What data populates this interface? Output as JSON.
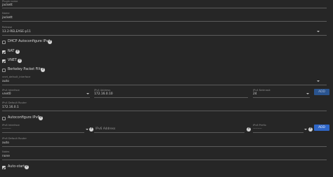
{
  "top_field": {
    "label": "Plugin name",
    "value": "jackett"
  },
  "name_field": {
    "label": "Name",
    "value": "jackett"
  },
  "release_field": {
    "label": "Release",
    "value": "13.2-RELEASE-p11"
  },
  "dhcp": {
    "label": "DHCP Autoconfigure IPv4",
    "checked": false
  },
  "nat": {
    "label": "NAT",
    "checked": true
  },
  "vnet": {
    "label": "VNET",
    "checked": true
  },
  "bpf": {
    "label": "Berkeley Packet Filter",
    "checked": false
  },
  "vnet_default": {
    "label": "vnet_default_interface",
    "value": "auto"
  },
  "ipv4": {
    "interface_label": "IPv4 Interface",
    "interface_value": "vnet0",
    "address_label": "IPv4 Address",
    "address_value": "172.16.0.10",
    "netmask_label": "IPv4 Netmask",
    "netmask_value": "24",
    "add_label": "ADD"
  },
  "ipv4_router": {
    "label": "IPv4 Default Router",
    "value": "172.16.0.1"
  },
  "auto_ipv6": {
    "label": "Autoconfigure IPv6",
    "checked": false
  },
  "ipv6": {
    "interface_label": "IPv6 Interface",
    "interface_value": "--------",
    "address_placeholder": "IPv6 Address",
    "prefix_label": "IPv6 Prefix",
    "prefix_value": "--------",
    "add_label": "ADD"
  },
  "ipv6_router": {
    "label": "IPv6 Default Router",
    "value": "auto"
  },
  "notes": {
    "label": "Notes",
    "value": "none"
  },
  "autostart": {
    "label": "Auto-start",
    "checked": true
  },
  "colors": {
    "background": "#262626",
    "accent": "#2f66c7",
    "text": "#d6d6d6",
    "muted": "#8c8c8c"
  }
}
